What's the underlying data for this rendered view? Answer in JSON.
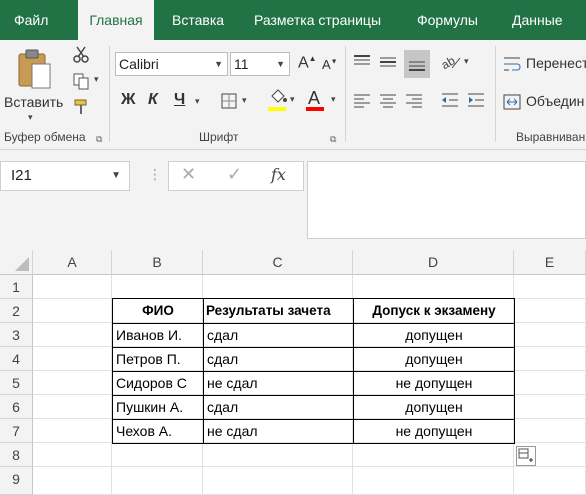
{
  "tabs": [
    "Файл",
    "Главная",
    "Вставка",
    "Разметка страницы",
    "Формулы",
    "Данные"
  ],
  "active_tab": "Главная",
  "clipboard": {
    "paste_label": "Вставить",
    "group_label": "Буфер обмена"
  },
  "font": {
    "family": "Calibri",
    "size": "11",
    "bold": "Ж",
    "italic": "К",
    "underline": "Ч",
    "grow": "A",
    "shrink": "A",
    "color_letter": "A",
    "group_label": "Шрифт",
    "highlight_color": "#ffff00",
    "font_color": "#ff0000"
  },
  "alignment": {
    "wrap_label": "Перенест",
    "merge_label": "Объедин",
    "group_label": "Выравниван"
  },
  "formula_bar": {
    "name_box": "I21",
    "fx": "fx",
    "value": ""
  },
  "columns": [
    "A",
    "B",
    "C",
    "D",
    "E"
  ],
  "rows": [
    "1",
    "2",
    "3",
    "4",
    "5",
    "6",
    "7",
    "8",
    "9"
  ],
  "table": {
    "headers": [
      "ФИО",
      "Результаты зачета",
      "Допуск к экзамену"
    ],
    "rows": [
      [
        "Иванов И.",
        "сдал",
        "допущен"
      ],
      [
        "Петров П.",
        "сдал",
        "допущен"
      ],
      [
        "Сидоров С",
        "не сдал",
        "не допущен"
      ],
      [
        "Пушкин А.",
        "сдал",
        "допущен"
      ],
      [
        "Чехов А.",
        "не сдал",
        "не допущен"
      ]
    ]
  }
}
